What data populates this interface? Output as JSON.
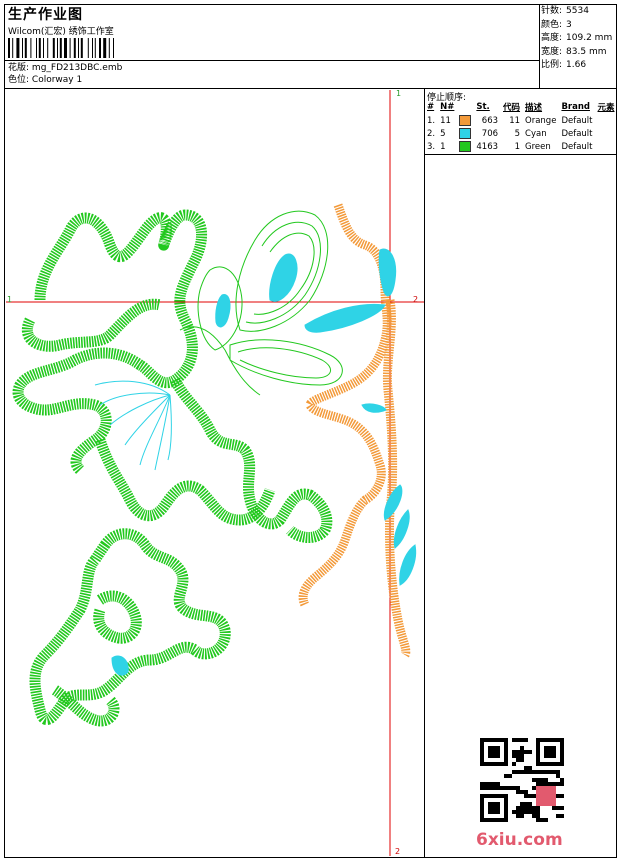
{
  "header": {
    "title": "生产作业图",
    "company": "Wilcom(汇宏) 绣饰工作室",
    "design_label": "花版:",
    "design_file": "mg_FD213DBC.emb",
    "colorway_label": "色位:",
    "colorway": "Colorway 1"
  },
  "specs": [
    {
      "label": "针数:",
      "value": "5534"
    },
    {
      "label": "颜色:",
      "value": "3"
    },
    {
      "label": "高度:",
      "value": "109.2 mm"
    },
    {
      "label": "宽度:",
      "value": "83.5 mm"
    },
    {
      "label": "比例:",
      "value": "1.66"
    }
  ],
  "stop_sequence": {
    "title": "停止顺序:",
    "columns": [
      "#",
      "N#",
      "St.",
      "代码",
      "描述",
      "Brand",
      "元素"
    ],
    "rows": [
      {
        "num": "1.",
        "n": "11",
        "color": "#f39a3a",
        "st": "663",
        "code": "11",
        "desc": "Orange",
        "brand": "Default"
      },
      {
        "num": "2.",
        "n": "5",
        "color": "#2fd3e6",
        "st": "706",
        "code": "5",
        "desc": "Cyan",
        "brand": "Default"
      },
      {
        "num": "3.",
        "n": "1",
        "color": "#22c81e",
        "st": "4163",
        "code": "1",
        "desc": "Green",
        "brand": "Default"
      }
    ]
  },
  "markers": {
    "top": "1",
    "left": "1",
    "right": "2",
    "bottom": "2"
  },
  "watermark": "6xiu.com",
  "colors": {
    "green": "#22c81e",
    "orange": "#f39a3a",
    "cyan": "#2fd3e6",
    "crosshair": "#e00000"
  }
}
